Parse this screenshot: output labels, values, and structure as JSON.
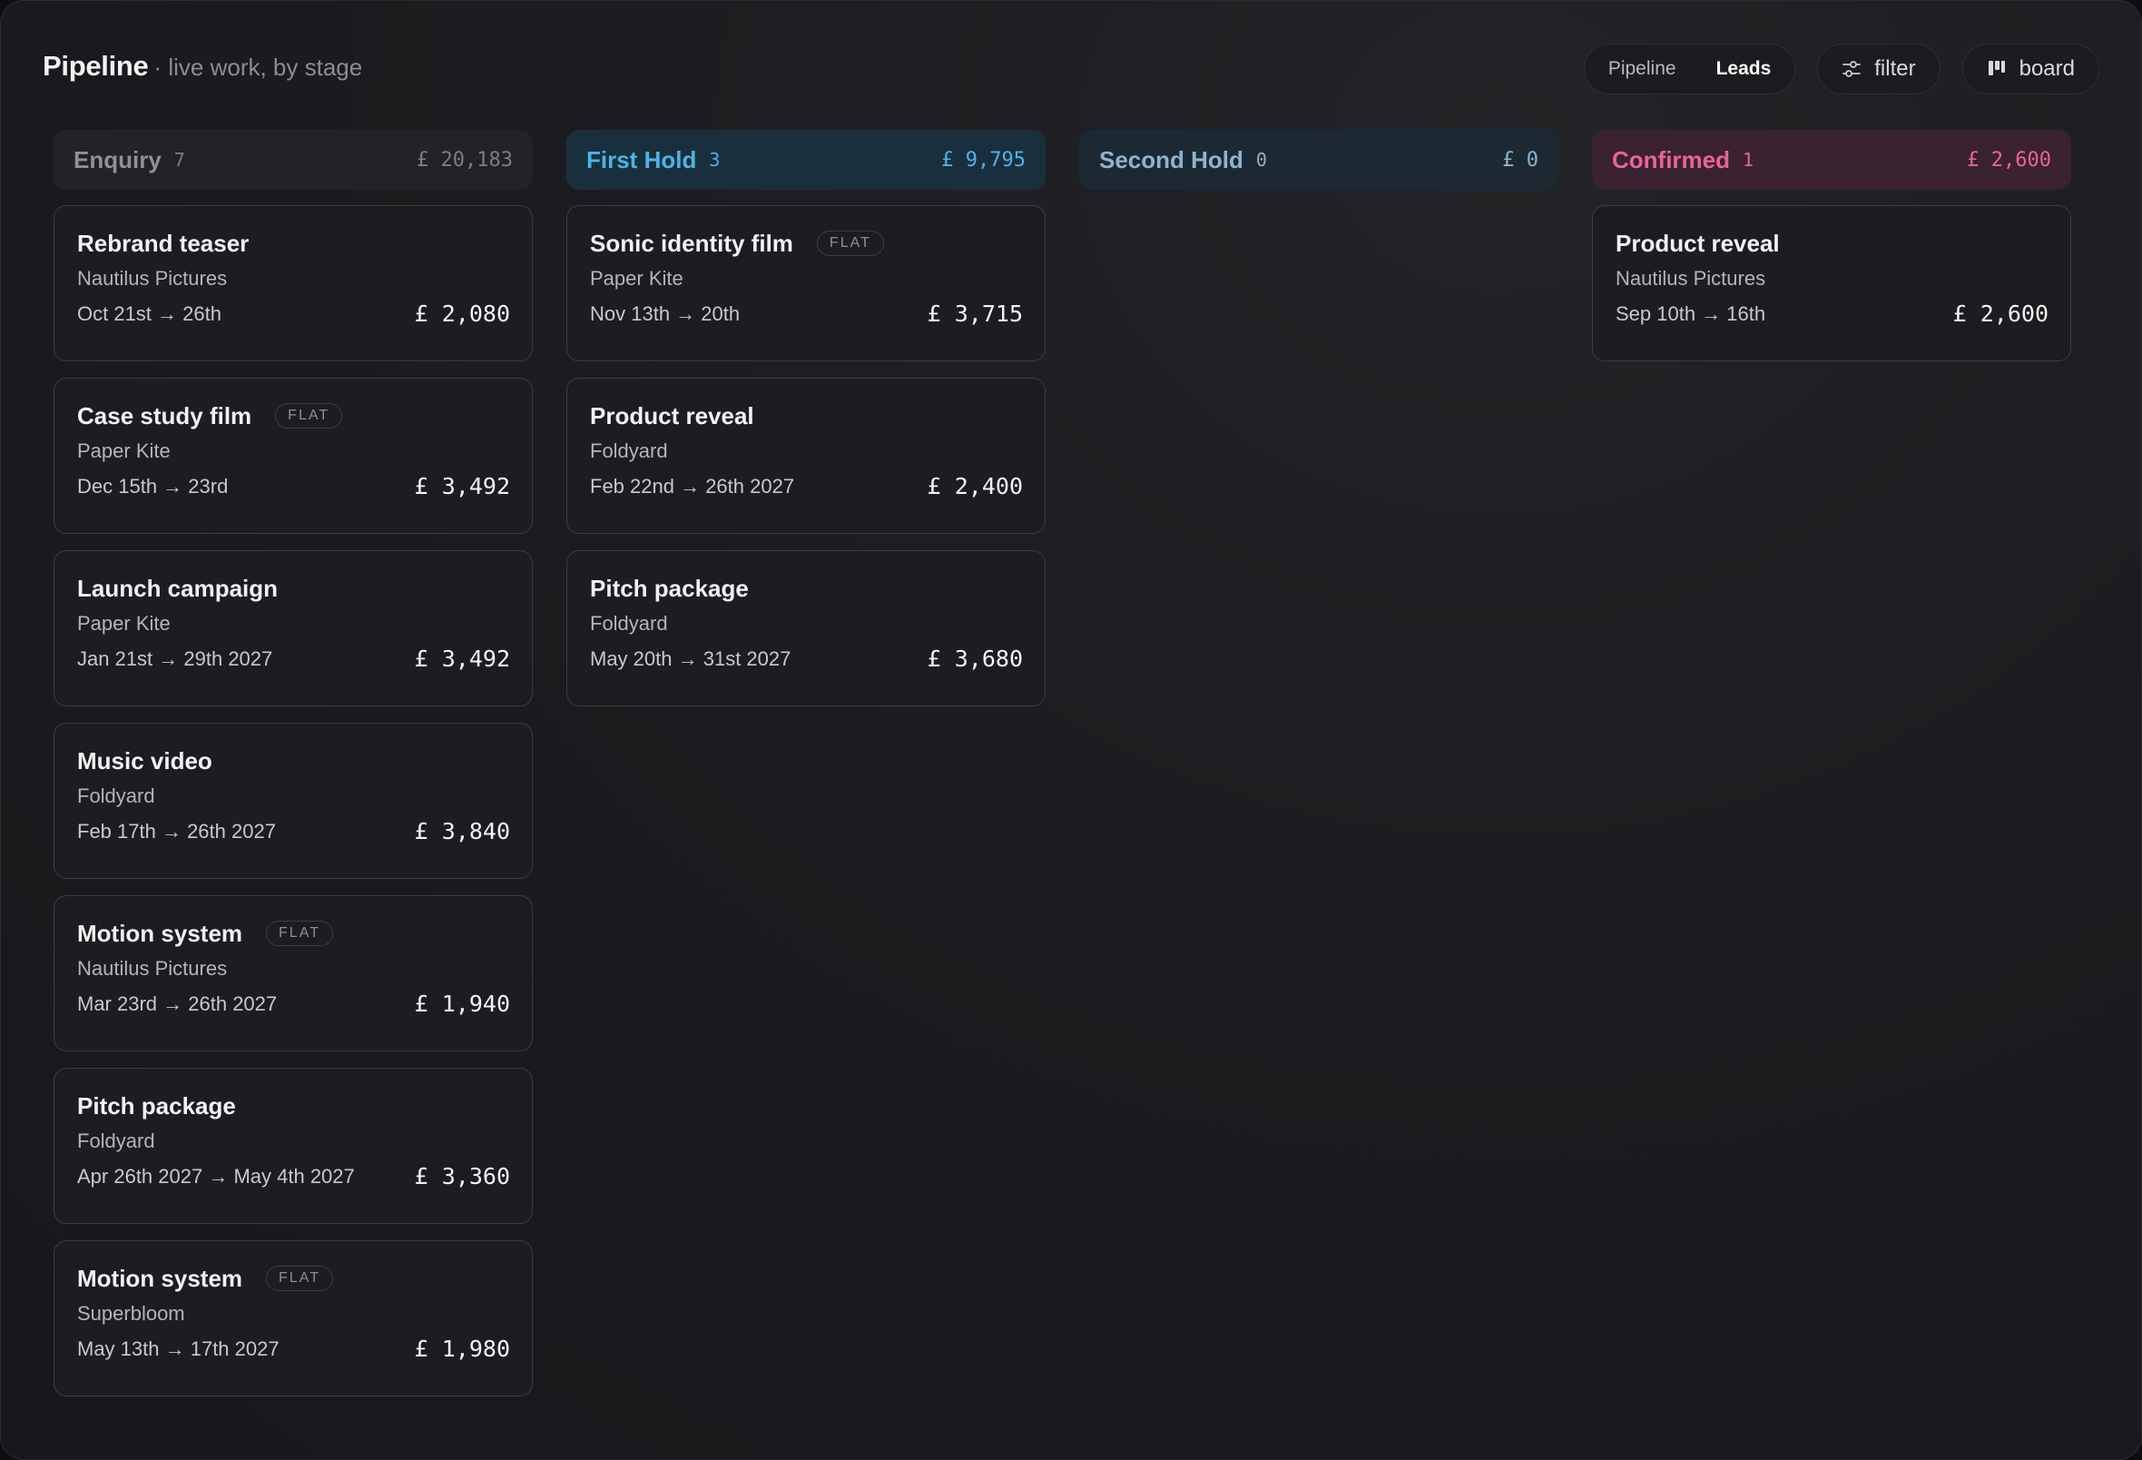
{
  "header": {
    "title": "Pipeline",
    "subtitle": "· live work, by stage"
  },
  "controls": {
    "segment": [
      "Pipeline",
      "Leads"
    ],
    "active_segment": "Leads",
    "filter_label": "filter",
    "board_label": "board"
  },
  "columns": [
    {
      "name": "Enquiry",
      "count": "7",
      "total": "£ 20,183",
      "cards": [
        {
          "title": "Rebrand teaser",
          "flat": "",
          "client": "Nautilus Pictures",
          "dates": "Oct 21st → 26th",
          "amount": "£ 2,080"
        },
        {
          "title": "Case study film",
          "flat": "FLAT",
          "client": "Paper Kite",
          "dates": "Dec 15th → 23rd",
          "amount": "£ 3,492"
        },
        {
          "title": "Launch campaign",
          "flat": "",
          "client": "Paper Kite",
          "dates": "Jan 21st → 29th 2027",
          "amount": "£ 3,492"
        },
        {
          "title": "Music video",
          "flat": "",
          "client": "Foldyard",
          "dates": "Feb 17th → 26th 2027",
          "amount": "£ 3,840"
        },
        {
          "title": "Motion system",
          "flat": "FLAT",
          "client": "Nautilus Pictures",
          "dates": "Mar 23rd → 26th 2027",
          "amount": "£ 1,940"
        },
        {
          "title": "Pitch package",
          "flat": "",
          "client": "Foldyard",
          "dates": "Apr 26th 2027 → May 4th 2027",
          "amount": "£ 3,360"
        },
        {
          "title": "Motion system",
          "flat": "FLAT",
          "client": "Superbloom",
          "dates": "May 13th → 17th 2027",
          "amount": "£ 1,980"
        }
      ]
    },
    {
      "name": "First Hold",
      "count": "3",
      "total": "£ 9,795",
      "cards": [
        {
          "title": "Sonic identity film",
          "flat": "FLAT",
          "client": "Paper Kite",
          "dates": "Nov 13th → 20th",
          "amount": "£ 3,715"
        },
        {
          "title": "Product reveal",
          "flat": "",
          "client": "Foldyard",
          "dates": "Feb 22nd → 26th 2027",
          "amount": "£ 2,400"
        },
        {
          "title": "Pitch package",
          "flat": "",
          "client": "Foldyard",
          "dates": "May 20th → 31st 2027",
          "amount": "£ 3,680"
        }
      ]
    },
    {
      "name": "Second Hold",
      "count": "0",
      "total": "£ 0",
      "cards": []
    },
    {
      "name": "Confirmed",
      "count": "1",
      "total": "£ 2,600",
      "cards": [
        {
          "title": "Product reveal",
          "flat": "",
          "client": "Nautilus Pictures",
          "dates": "Sep 10th → 16th",
          "amount": "£ 2,600"
        }
      ]
    }
  ],
  "colors": {
    "first_hold": "#4cb3e6",
    "second_hold": "#8fb4cd",
    "confirmed": "#e8649c",
    "enquiry": "#8f9197"
  }
}
